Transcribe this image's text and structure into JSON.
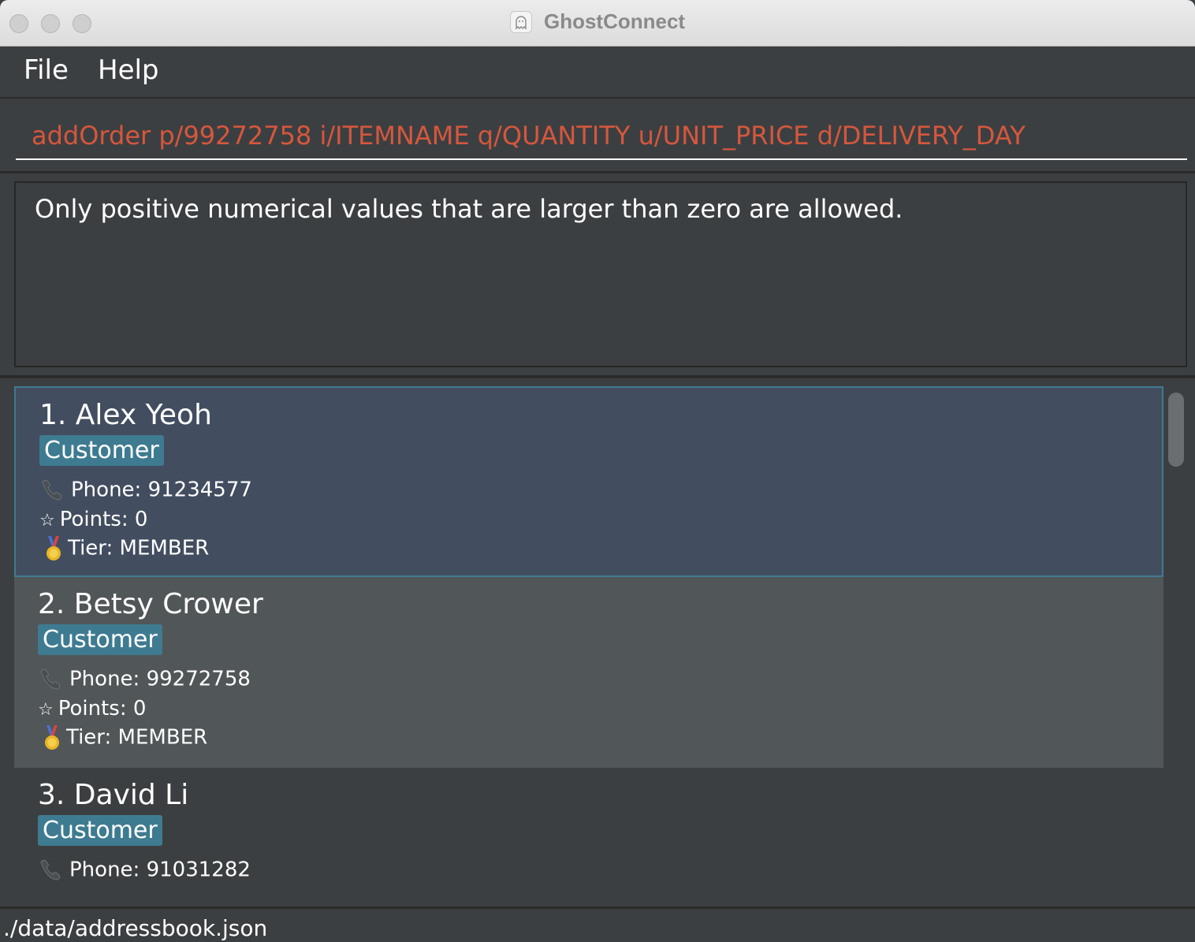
{
  "window": {
    "title": "GhostConnect"
  },
  "menu": {
    "file": "File",
    "help": "Help"
  },
  "command": {
    "value": "addOrder p/99272758 i/ITEMNAME q/QUANTITY u/UNIT_PRICE d/DELIVERY_DAY"
  },
  "result": {
    "message": "Only positive numerical values that are larger than zero are allowed."
  },
  "persons": [
    {
      "name": "1. Alex Yeoh",
      "tag": "Customer",
      "phone": "Phone: 91234577",
      "points": "Points: 0",
      "tier": "Tier: MEMBER"
    },
    {
      "name": "2. Betsy Crower",
      "tag": "Customer",
      "phone": "Phone: 99272758",
      "points": "Points: 0",
      "tier": "Tier: MEMBER"
    },
    {
      "name": "3. David Li",
      "tag": "Customer",
      "phone": "Phone: 91031282"
    }
  ],
  "status": {
    "path": "./data/addressbook.json"
  },
  "colors": {
    "accent": "#3e7b91",
    "command_text": "#d5573d",
    "selected_card": "#424d5f"
  },
  "icons": {
    "phone": "phone-icon",
    "points": "star-icon",
    "tier": "medal-icon"
  }
}
